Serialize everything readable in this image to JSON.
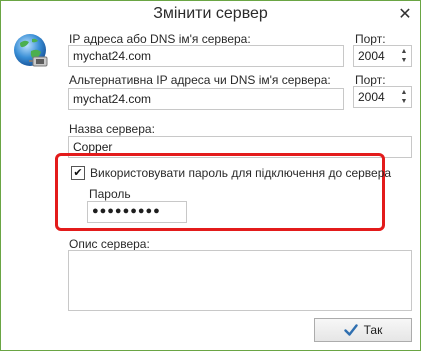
{
  "window": {
    "title": "Змінити сервер",
    "close_glyph": "✕"
  },
  "server": {
    "address_label": "IP адреса або DNS ім'я сервера:",
    "address_value": "mychat24.com",
    "port_label": "Порт:",
    "port_value": "2004"
  },
  "alt_server": {
    "address_label": "Альтернативна IP адреса чи DNS ім'я сервера:",
    "address_value": "mychat24.com",
    "port_label": "Порт:",
    "port_value": "2004"
  },
  "name": {
    "label": "Назва сервера:",
    "value": "Copper"
  },
  "password": {
    "use_label": "Використовувати пароль для підключення до сервера",
    "checked": true,
    "check_glyph": "✔",
    "label": "Пароль",
    "value": "●●●●●●●●●"
  },
  "description": {
    "label": "Опис сервера:",
    "value": ""
  },
  "ok_button": {
    "label": "Так"
  },
  "icons": {
    "globe": "globe-network-icon",
    "check": "check-icon",
    "close": "close-icon"
  },
  "colors": {
    "window_border": "#6aa544",
    "highlight": "#e31b1b",
    "check_icon": "#2f6fb0"
  }
}
